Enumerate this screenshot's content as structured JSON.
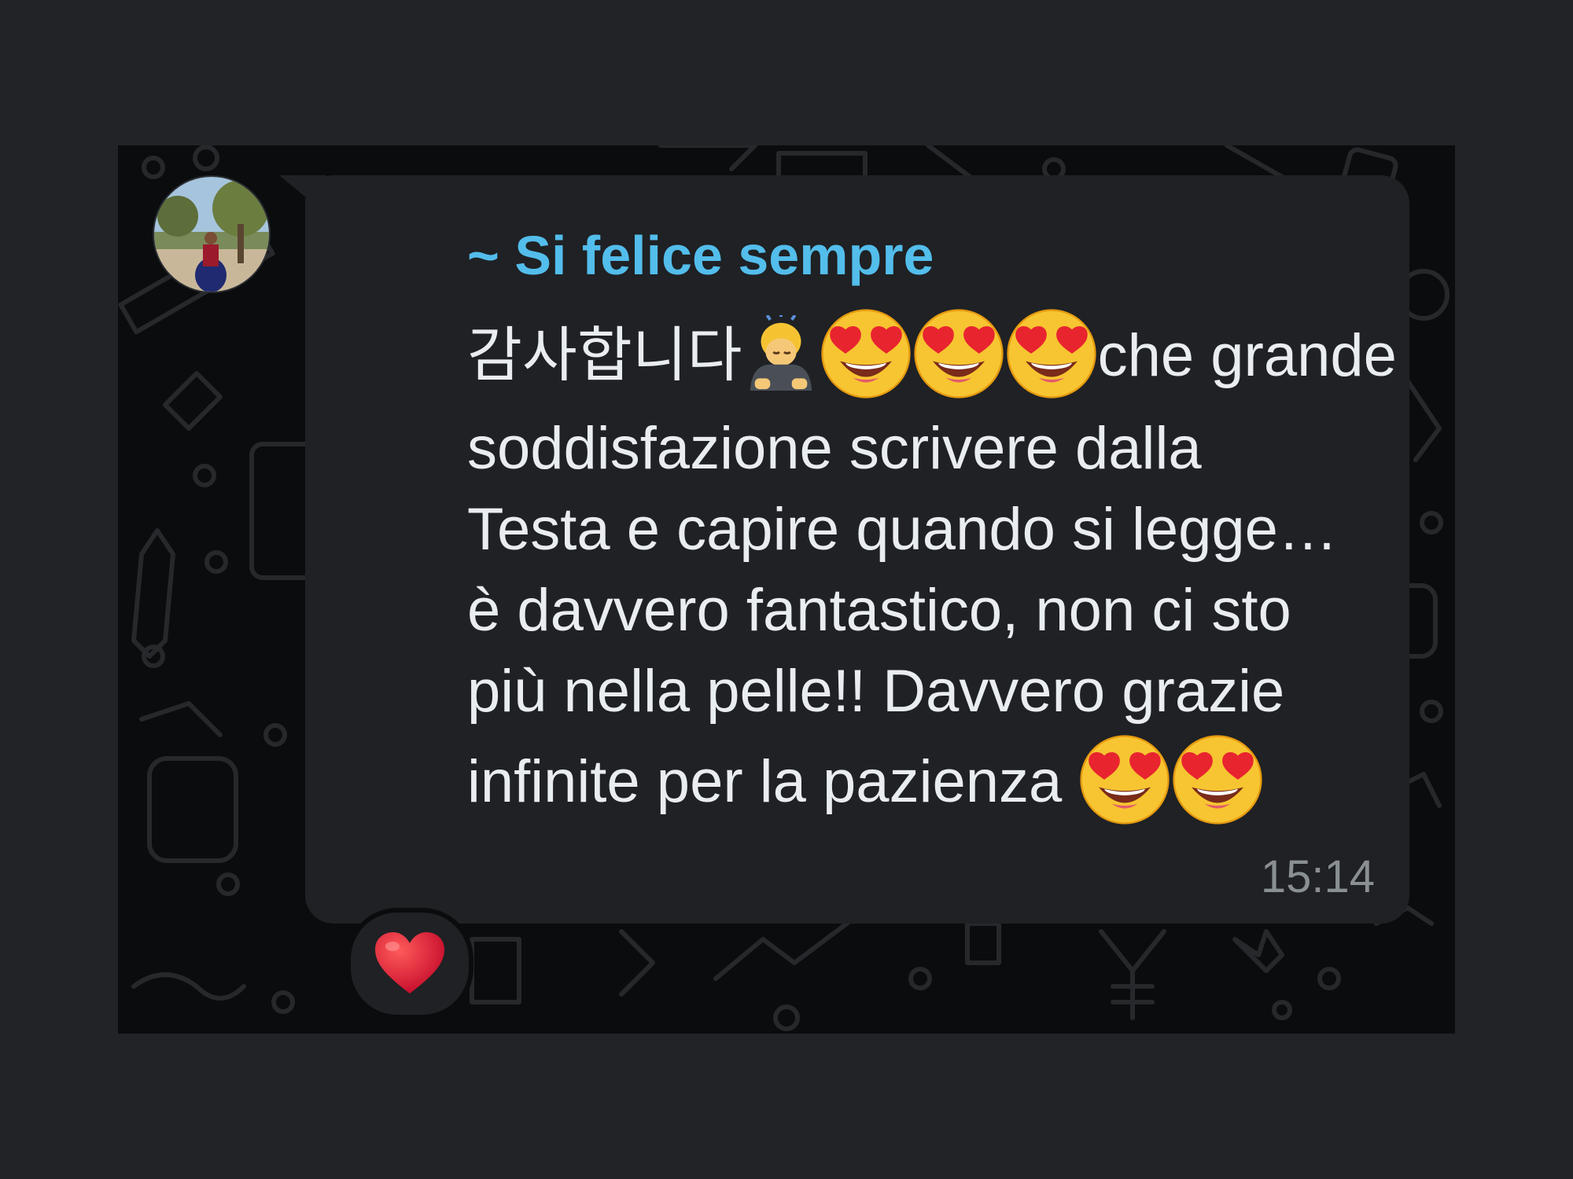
{
  "chat": {
    "sender_name": "~ Si felice sempre",
    "message": {
      "lines": [
        {
          "parts": [
            {
              "t": "text",
              "v": "감사합니다"
            },
            {
              "t": "emoji",
              "icon": "person-bowing-emoji"
            },
            {
              "t": "emoji",
              "icon": "heart-eyes-emoji"
            },
            {
              "t": "emoji",
              "icon": "heart-eyes-emoji"
            },
            {
              "t": "emoji",
              "icon": "heart-eyes-emoji"
            },
            {
              "t": "text",
              "v": "che grande"
            }
          ]
        },
        {
          "parts": [
            {
              "t": "text",
              "v": "soddisfazione scrivere dalla"
            }
          ]
        },
        {
          "parts": [
            {
              "t": "text",
              "v": "Testa e capire quando si legge…"
            }
          ]
        },
        {
          "parts": [
            {
              "t": "text",
              "v": "è davvero fantastico, non ci sto"
            }
          ]
        },
        {
          "parts": [
            {
              "t": "text",
              "v": "più nella pelle!!  Davvero grazie"
            }
          ]
        },
        {
          "parts": [
            {
              "t": "text",
              "v": "infinite per la pazienza "
            },
            {
              "t": "emoji",
              "icon": "heart-eyes-emoji"
            },
            {
              "t": "emoji",
              "icon": "heart-eyes-emoji"
            }
          ]
        }
      ]
    },
    "timestamp": "15:14",
    "reaction_icon": "red-heart-icon"
  },
  "colors": {
    "page_bg": "#212327",
    "chat_bg": "#0b0c0d",
    "bubble_bg": "#1f2124",
    "sender_name": "#53bdeb",
    "message_text": "#e9edef",
    "timestamp": "#8a8f93"
  }
}
